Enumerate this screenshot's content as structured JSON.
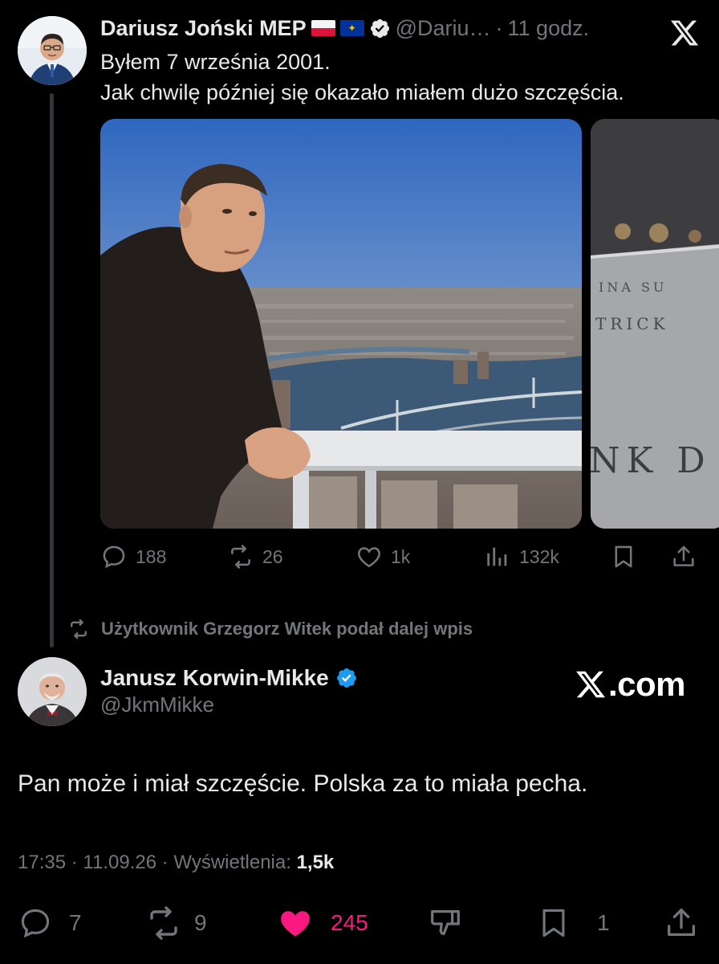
{
  "parent_tweet": {
    "author_name": "Dariusz Joński MEP",
    "flags": [
      "poland-flag",
      "eu-flag"
    ],
    "handle": "@Dariu…",
    "separator": "·",
    "time_ago": "11 godz.",
    "text_line1": "Byłem 7 września 2001.",
    "text_line2": "Jak chwilę później się okazało miałem dużo szczęścia.",
    "photos": [
      "man-on-wtc-observation-deck-photo",
      "memorial-engraved-names-photo"
    ],
    "stats": {
      "replies": "188",
      "reposts": "26",
      "likes": "1k",
      "views": "132k"
    }
  },
  "retweet_note": "Użytkownik Grzegorz Witek podał dalej wpis",
  "reply_tweet": {
    "author_name": "Janusz Korwin-Mikke",
    "handle": "@JkmMikke",
    "watermark": ".com",
    "text": "Pan może i miał szczęście. Polska za to miała pecha.",
    "time": "17:35",
    "date": "11.09.26",
    "separator": "·",
    "views_label": "Wyświetlenia:",
    "views_value": "1,5k",
    "stats": {
      "replies": "7",
      "reposts": "9",
      "likes": "245",
      "bookmarks": "1"
    }
  },
  "colors": {
    "background": "#000000",
    "text": "#e7e9ea",
    "muted": "#71767b",
    "like": "#f91880",
    "verified": "#1d9bf0"
  }
}
